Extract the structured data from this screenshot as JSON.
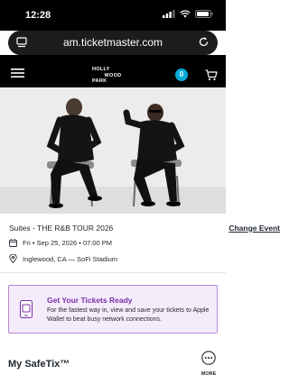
{
  "status_bar": {
    "time": "12:28"
  },
  "browser": {
    "url": "am.ticketmaster.com"
  },
  "header": {
    "logo_lines": [
      "HOLLY",
      "WOOD",
      "PARK"
    ],
    "cart_count": "0"
  },
  "event": {
    "title": "Suites - THE R&B TOUR 2026",
    "change_label": "Change Event",
    "datetime": "Fri • Sep 25, 2026 • 07:00 PM",
    "venue": "Inglewood, CA — SoFi Stadium"
  },
  "notice": {
    "title": "Get Your Tickets Ready",
    "body": "For the fastest way in, view and save your tickets to Apple Wallet to beat busy network connections."
  },
  "safetix": {
    "title": "My SafeTix™",
    "more_label": "MORE"
  },
  "colors": {
    "accent_blue": "#06a9d9",
    "notice_purple": "#7a2ea8",
    "notice_bg": "#f4ecfb"
  }
}
